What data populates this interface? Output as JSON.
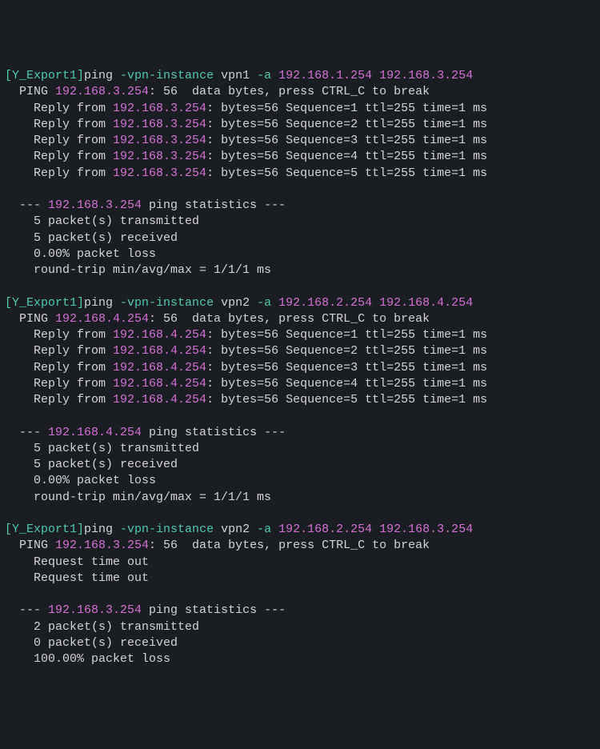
{
  "sessions": [
    {
      "prompt_host": "[Y_Export1]",
      "cmd_name": "ping",
      "flag1": "-vpn-instance",
      "vpn": "vpn1",
      "flag2": "-a",
      "src_ip": "192.168.1.254",
      "dst_ip": "192.168.3.254",
      "ping_header_prefix": "  PING ",
      "ping_header_ip": "192.168.3.254",
      "ping_header_suffix": ": 56  data bytes, press CTRL_C to break",
      "replies": [
        {
          "prefix": "    Reply from ",
          "ip": "192.168.3.254",
          "suffix": ": bytes=56 Sequence=1 ttl=255 time=1 ms"
        },
        {
          "prefix": "    Reply from ",
          "ip": "192.168.3.254",
          "suffix": ": bytes=56 Sequence=2 ttl=255 time=1 ms"
        },
        {
          "prefix": "    Reply from ",
          "ip": "192.168.3.254",
          "suffix": ": bytes=56 Sequence=3 ttl=255 time=1 ms"
        },
        {
          "prefix": "    Reply from ",
          "ip": "192.168.3.254",
          "suffix": ": bytes=56 Sequence=4 ttl=255 time=1 ms"
        },
        {
          "prefix": "    Reply from ",
          "ip": "192.168.3.254",
          "suffix": ": bytes=56 Sequence=5 ttl=255 time=1 ms"
        }
      ],
      "stats_open": "  --- ",
      "stats_ip": "192.168.3.254",
      "stats_close": " ping statistics ---",
      "stat_lines": [
        "    5 packet(s) transmitted",
        "    5 packet(s) received",
        "    0.00% packet loss",
        "    round-trip min/avg/max = 1/1/1 ms"
      ]
    },
    {
      "prompt_host": "[Y_Export1]",
      "cmd_name": "ping",
      "flag1": "-vpn-instance",
      "vpn": "vpn2",
      "flag2": "-a",
      "src_ip": "192.168.2.254",
      "dst_ip": "192.168.4.254",
      "ping_header_prefix": "  PING ",
      "ping_header_ip": "192.168.4.254",
      "ping_header_suffix": ": 56  data bytes, press CTRL_C to break",
      "replies": [
        {
          "prefix": "    Reply from ",
          "ip": "192.168.4.254",
          "suffix": ": bytes=56 Sequence=1 ttl=255 time=1 ms"
        },
        {
          "prefix": "    Reply from ",
          "ip": "192.168.4.254",
          "suffix": ": bytes=56 Sequence=2 ttl=255 time=1 ms"
        },
        {
          "prefix": "    Reply from ",
          "ip": "192.168.4.254",
          "suffix": ": bytes=56 Sequence=3 ttl=255 time=1 ms"
        },
        {
          "prefix": "    Reply from ",
          "ip": "192.168.4.254",
          "suffix": ": bytes=56 Sequence=4 ttl=255 time=1 ms"
        },
        {
          "prefix": "    Reply from ",
          "ip": "192.168.4.254",
          "suffix": ": bytes=56 Sequence=5 ttl=255 time=1 ms"
        }
      ],
      "stats_open": "  --- ",
      "stats_ip": "192.168.4.254",
      "stats_close": " ping statistics ---",
      "stat_lines": [
        "    5 packet(s) transmitted",
        "    5 packet(s) received",
        "    0.00% packet loss",
        "    round-trip min/avg/max = 1/1/1 ms"
      ]
    },
    {
      "prompt_host": "[Y_Export1]",
      "cmd_name": "ping",
      "flag1": "-vpn-instance",
      "vpn": "vpn2",
      "flag2": "-a",
      "src_ip": "192.168.2.254",
      "dst_ip": "192.168.3.254",
      "ping_header_prefix": "  PING ",
      "ping_header_ip": "192.168.3.254",
      "ping_header_suffix": ": 56  data bytes, press CTRL_C to break",
      "timeouts": [
        "    Request time out",
        "    Request time out"
      ],
      "stats_open": "  --- ",
      "stats_ip": "192.168.3.254",
      "stats_close": " ping statistics ---",
      "stat_lines": [
        "    2 packet(s) transmitted",
        "    0 packet(s) received",
        "    100.00% packet loss"
      ]
    }
  ]
}
